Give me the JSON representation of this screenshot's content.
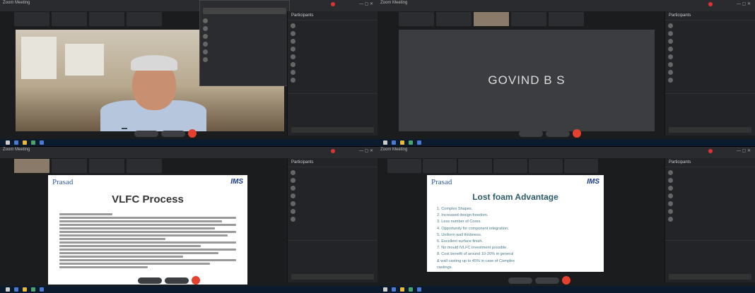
{
  "q1": {
    "title": "Zoom Meeting",
    "thumbs": [
      "",
      "",
      "",
      ""
    ],
    "name_tag": "",
    "popup_title": "",
    "panel_title": "Participants",
    "participants": [
      "",
      "",
      "",
      "",
      "",
      "",
      "",
      "",
      ""
    ],
    "controls": [
      "",
      ""
    ],
    "taskbar_time": ""
  },
  "q2": {
    "title": "Zoom Meeting",
    "thumbs": [
      "",
      "",
      "",
      "",
      ""
    ],
    "speaker_name": "GOVIND B S",
    "panel_title": "Participants",
    "participants": [
      "",
      "",
      "",
      "",
      "",
      "",
      "",
      "",
      ""
    ],
    "controls": [
      "",
      ""
    ],
    "taskbar_time": ""
  },
  "q3": {
    "title": "Zoom Meeting",
    "thumbs": [
      "",
      "",
      "",
      ""
    ],
    "slide": {
      "logo_left": "Prasad",
      "logo_right": "IMS",
      "title": "VLFC Process"
    },
    "panel_title": "Participants",
    "participants": [
      "",
      "",
      "",
      "",
      "",
      "",
      "",
      ""
    ],
    "controls": [
      "",
      ""
    ],
    "taskbar_time": ""
  },
  "q4": {
    "title": "Zoom Meeting",
    "thumbs": [
      "",
      "",
      "",
      "",
      "",
      "",
      ""
    ],
    "slide": {
      "logo_left": "Prasad",
      "logo_right": "IMS",
      "title": "Lost foam Advantage",
      "items": [
        "1.   Complex Shapes.",
        "2.   Increased design freedom.",
        "3.   Less number of Cores.",
        "4.   Opportunity for component integration.",
        "5.   Uniform wall thickness.",
        "6.   Excellent surface finish.",
        "7.   No mould /VLFC investment possible.",
        "8.   Cost benefit of around 10-20% in general",
        "      & wall casting up to 45% in case of Complex",
        "      castings."
      ]
    },
    "panel_title": "Participants",
    "participants": [
      "",
      "",
      "",
      "",
      "",
      "",
      "",
      ""
    ],
    "controls": [
      "",
      ""
    ],
    "taskbar_time": ""
  }
}
